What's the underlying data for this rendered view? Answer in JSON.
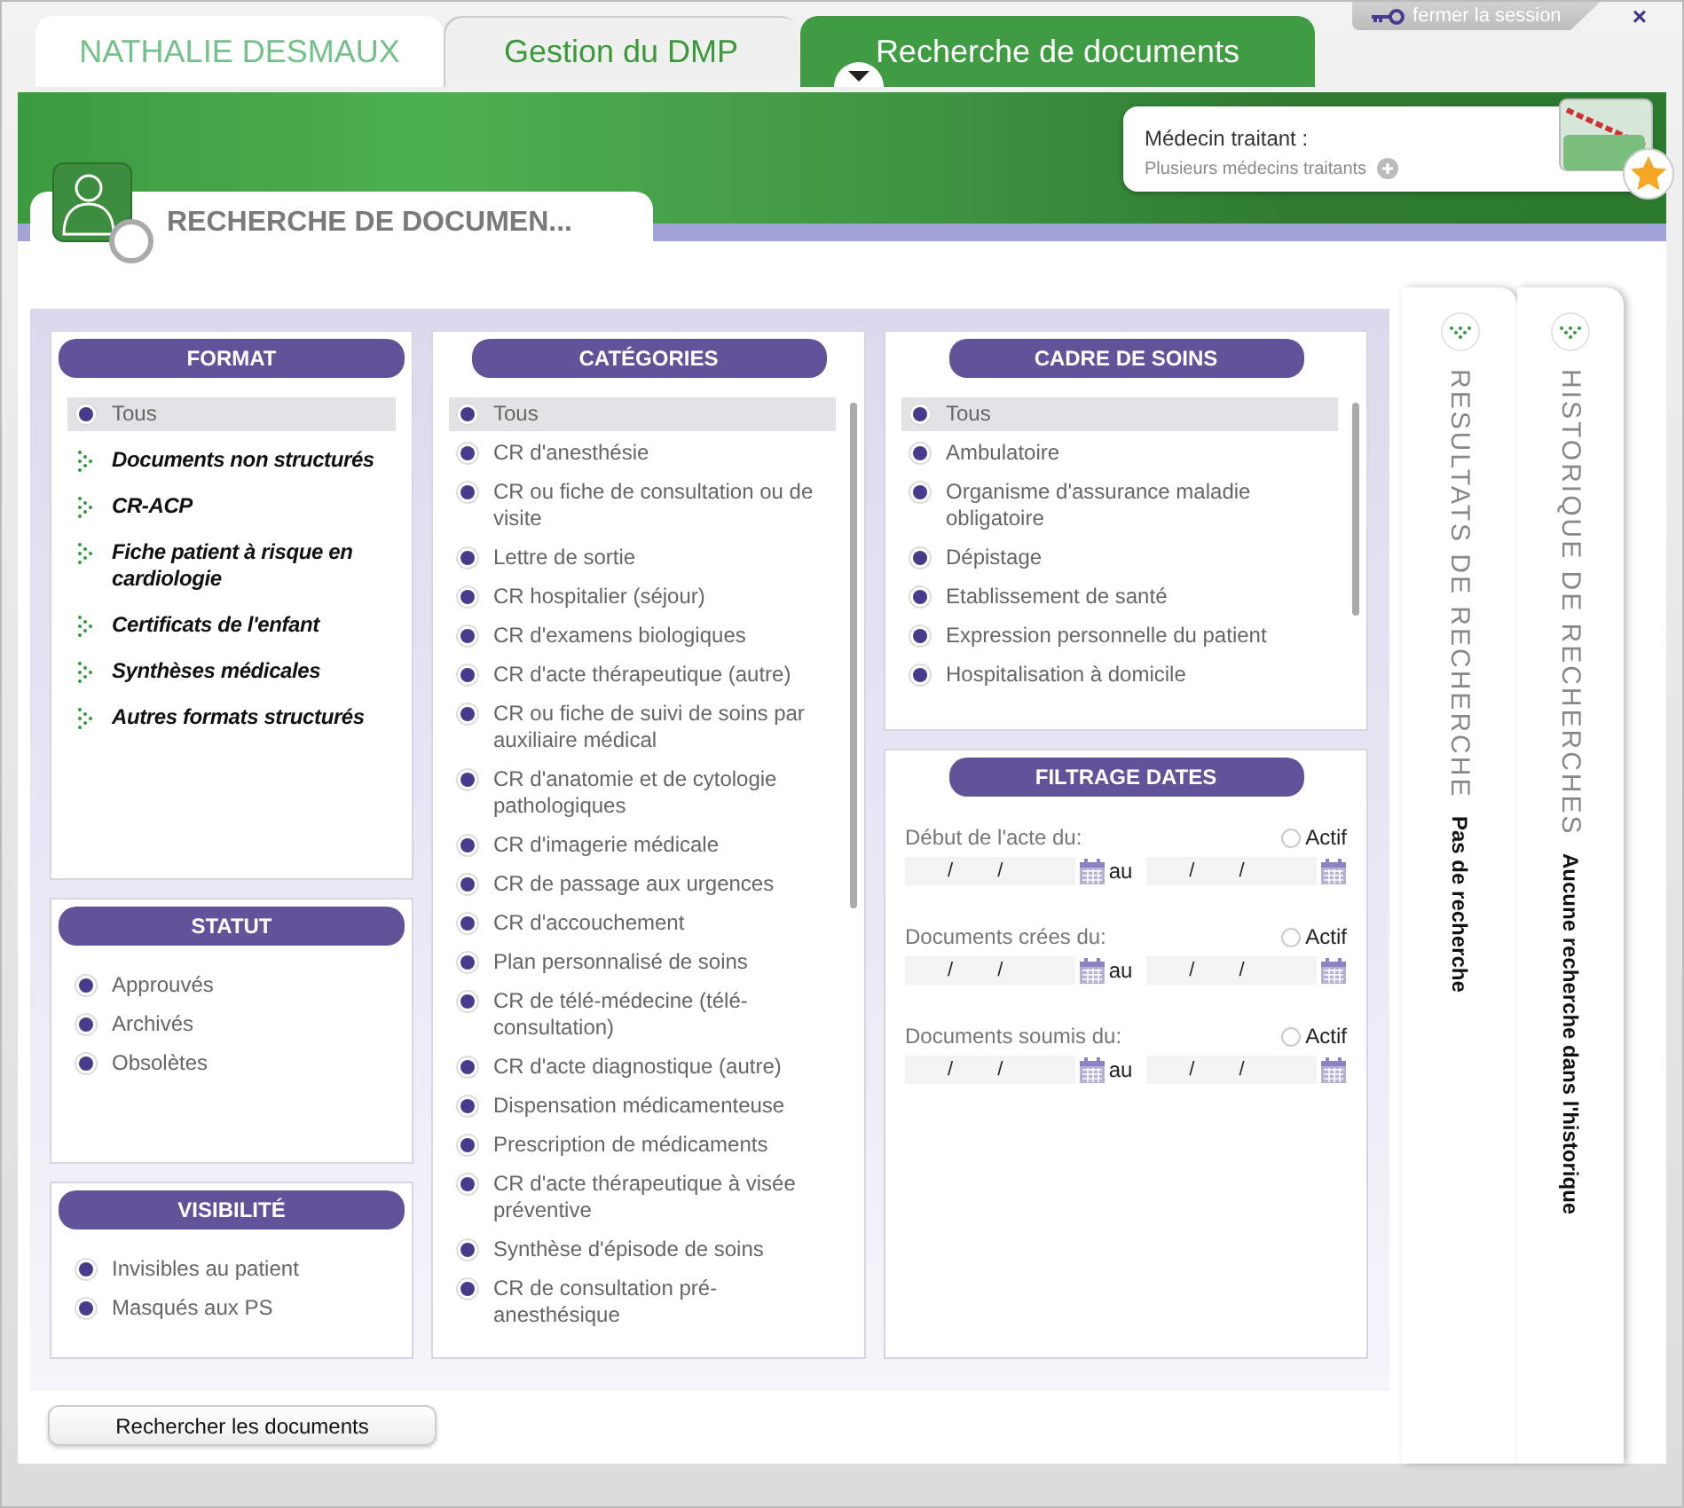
{
  "session": {
    "logout": "fermer la session",
    "close": "×"
  },
  "tabs": [
    {
      "label": "NATHALIE DESMAUX",
      "kind": "patient",
      "selected": false
    },
    {
      "label": "Gestion du DMP",
      "kind": "section",
      "selected": false
    },
    {
      "label": "Recherche de documents",
      "kind": "section",
      "selected": true
    }
  ],
  "doctor": {
    "label": "Médecin traitant :",
    "value": "Plusieurs médecins traitants"
  },
  "page_title": "RECHERCHE DE DOCUMEN...",
  "format": {
    "title": "FORMAT",
    "items": [
      {
        "label": "Tous",
        "kind": "option",
        "checked": true,
        "selected": true
      },
      {
        "label": "Documents non structurés",
        "kind": "group",
        "expanded": false
      },
      {
        "label": "CR-ACP",
        "kind": "group",
        "expanded": false
      },
      {
        "label": "Fiche patient à risque en cardiologie",
        "kind": "group",
        "expanded": false
      },
      {
        "label": "Certificats de l'enfant",
        "kind": "group",
        "expanded": false
      },
      {
        "label": "Synthèses médicales",
        "kind": "group",
        "expanded": false
      },
      {
        "label": "Autres formats structurés",
        "kind": "group",
        "expanded": false
      }
    ]
  },
  "statut": {
    "title": "STATUT",
    "items": [
      {
        "label": "Approuvés",
        "checked": true
      },
      {
        "label": "Archivés",
        "checked": true
      },
      {
        "label": "Obsolètes",
        "checked": true
      }
    ]
  },
  "visibilite": {
    "title": "VISIBILITÉ",
    "items": [
      {
        "label": "Invisibles au patient",
        "checked": true
      },
      {
        "label": "Masqués aux PS",
        "checked": true
      }
    ]
  },
  "categories": {
    "title": "CATÉGORIES",
    "items": [
      {
        "label": "Tous",
        "checked": true,
        "selected": true
      },
      {
        "label": "CR d'anesthésie",
        "checked": true,
        "selected": false
      },
      {
        "label": "CR ou fiche de consultation ou de visite",
        "checked": true,
        "selected": false
      },
      {
        "label": "Lettre de sortie",
        "checked": true,
        "selected": false
      },
      {
        "label": "CR hospitalier (séjour)",
        "checked": true,
        "selected": false
      },
      {
        "label": "CR d'examens biologiques",
        "checked": true,
        "selected": false
      },
      {
        "label": "CR d'acte thérapeutique (autre)",
        "checked": true,
        "selected": false
      },
      {
        "label": "CR ou fiche de suivi de soins par auxiliaire médical",
        "checked": true,
        "selected": false
      },
      {
        "label": "CR d'anatomie et de cytologie pathologiques",
        "checked": true,
        "selected": false
      },
      {
        "label": "CR d'imagerie médicale",
        "checked": true,
        "selected": false
      },
      {
        "label": "CR de passage aux urgences",
        "checked": true,
        "selected": false
      },
      {
        "label": "CR d'accouchement",
        "checked": true,
        "selected": false
      },
      {
        "label": "Plan personnalisé de soins",
        "checked": true,
        "selected": false
      },
      {
        "label": "CR de télé-médecine (télé-consultation)",
        "checked": true,
        "selected": false
      },
      {
        "label": "CR d'acte diagnostique (autre)",
        "checked": true,
        "selected": false
      },
      {
        "label": "Dispensation médicamenteuse",
        "checked": true,
        "selected": false
      },
      {
        "label": "Prescription de médicaments",
        "checked": true,
        "selected": false
      },
      {
        "label": "CR d'acte thérapeutique à visée préventive",
        "checked": true,
        "selected": false
      },
      {
        "label": "Synthèse d'épisode de soins",
        "checked": true,
        "selected": false
      },
      {
        "label": "CR de consultation pré-anesthésique",
        "checked": true,
        "selected": false
      }
    ]
  },
  "cadre": {
    "title": "CADRE DE SOINS",
    "items": [
      {
        "label": "Tous",
        "checked": true,
        "selected": true
      },
      {
        "label": "Ambulatoire",
        "checked": true,
        "selected": false
      },
      {
        "label": "Organisme d'assurance maladie obligatoire",
        "checked": true,
        "selected": false
      },
      {
        "label": "Dépistage",
        "checked": true,
        "selected": false
      },
      {
        "label": "Etablissement de santé",
        "checked": true,
        "selected": false
      },
      {
        "label": "Expression personnelle du patient",
        "checked": true,
        "selected": false
      },
      {
        "label": "Hospitalisation à domicile",
        "checked": true,
        "selected": false
      }
    ]
  },
  "dates": {
    "title": "FILTRAGE DATES",
    "filters": [
      {
        "label": "Début de l'acte du:",
        "active_label": "Actif",
        "active": false,
        "from_field": [
          "/",
          "/"
        ],
        "to_label": "au",
        "to_field": [
          "/",
          "/"
        ]
      },
      {
        "label": "Documents crées du:",
        "active_label": "Actif",
        "active": false,
        "from_field": [
          "/",
          "/"
        ],
        "to_label": "au",
        "to_field": [
          "/",
          "/"
        ]
      },
      {
        "label": "Documents soumis du:",
        "active_label": "Actif",
        "active": false,
        "from_field": [
          "/",
          "/"
        ],
        "to_label": "au",
        "to_field": [
          "/",
          "/"
        ]
      }
    ]
  },
  "search_button": "Rechercher les documents",
  "side_panels": [
    {
      "title": "RESULTATS DE RECHERCHE",
      "message": "Pas de recherche"
    },
    {
      "title": "HISTORIQUE DE RECHERCHES",
      "message": "Aucune recherche dans l'historique"
    }
  ]
}
